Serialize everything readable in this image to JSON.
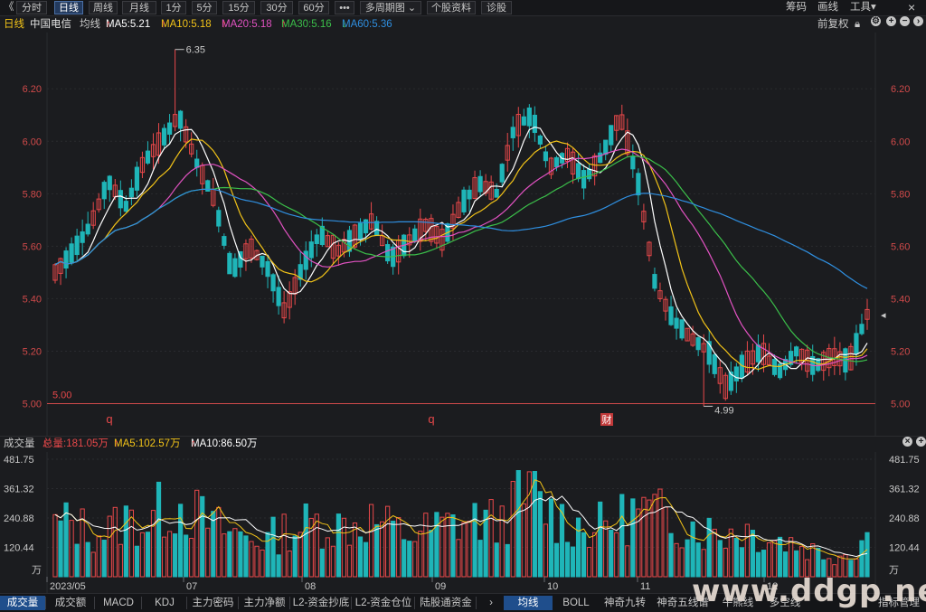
{
  "toolbar": {
    "back": "《",
    "periods": [
      "分时",
      "日线",
      "周线",
      "月线",
      "1分",
      "5分",
      "15分",
      "30分",
      "60分"
    ],
    "active_period": "日线",
    "more": "•••",
    "multi_period": "多周期图",
    "stock_info": "个股资料",
    "diagnose": "诊股",
    "right_tools": [
      "筹码",
      "画线",
      "工具"
    ],
    "close": "×"
  },
  "indicator_bar": {
    "period": "日线",
    "stock_name": "中国电信",
    "mode": "均线",
    "ma5": "MA5:5.21",
    "ma10": "MA10:5.18",
    "ma20": "MA20:5.18",
    "ma30": "MA30:5.16",
    "ma60": "MA60:5.36",
    "adjust": "前复权"
  },
  "colors": {
    "up": "#e8484a",
    "down": "#1fb5b8",
    "ma5": "#ffffff",
    "ma10": "#f2c318",
    "ma20": "#e252c2",
    "ma30": "#3bbf4a",
    "ma60": "#2f8fe0",
    "bg": "#1b1c1f",
    "grid": "#2a2b2f"
  },
  "price_axis": {
    "ticks": [
      "6.20",
      "6.00",
      "5.80",
      "5.60",
      "5.40",
      "5.20",
      "5.00"
    ]
  },
  "annotations": {
    "high": "6.35",
    "low": "4.99",
    "baseline": "5.00",
    "mark_q1": "q",
    "mark_q2": "q",
    "mark_cai": "财"
  },
  "volume_bar": {
    "label": "成交量",
    "total": "总量:181.05万",
    "ma5": "MA5:102.57万",
    "ma10": "MA10:86.50万",
    "ticks": [
      "481.75",
      "361.32",
      "240.88",
      "120.44"
    ],
    "unit": "万"
  },
  "date_axis": [
    "2023/05",
    "07",
    "08",
    "09",
    "10",
    "11",
    "12"
  ],
  "bottom_tabs": {
    "left": [
      "成交量",
      "成交额",
      "MACD",
      "KDJ",
      "主力密码",
      "主力净额",
      "L2-资金抄底",
      "L2-资金仓位",
      "陆股通资金"
    ],
    "right": [
      "均线",
      "BOLL",
      "神奇九转",
      "神奇五线谱",
      "牛熊线",
      "多空线",
      "指标管理"
    ],
    "active_left": "成交量",
    "active_right": "均线"
  },
  "watermark": "www.ddgp.net",
  "chart_data": {
    "type": "candlestick",
    "price_ylim": [
      4.95,
      6.38
    ],
    "volume_ylim": [
      0,
      481.75
    ],
    "candles_ohlc_sample": [
      [
        5.45,
        5.55,
        5.3,
        5.5
      ],
      [
        5.5,
        5.6,
        5.45,
        5.58
      ],
      [
        5.58,
        5.7,
        5.55,
        5.68
      ],
      [
        5.68,
        5.9,
        5.62,
        5.85
      ],
      [
        5.85,
        5.95,
        5.7,
        5.75
      ],
      [
        5.75,
        5.95,
        5.72,
        5.92
      ],
      [
        5.92,
        6.05,
        5.85,
        6.0
      ],
      [
        6.0,
        6.35,
        5.9,
        6.1
      ],
      [
        6.1,
        6.15,
        5.85,
        5.92
      ],
      [
        5.92,
        5.98,
        5.7,
        5.78
      ],
      [
        5.78,
        5.8,
        5.45,
        5.5
      ],
      [
        5.5,
        5.62,
        5.45,
        5.6
      ],
      [
        5.6,
        5.66,
        5.5,
        5.52
      ],
      [
        5.52,
        5.6,
        5.3,
        5.35
      ],
      [
        5.35,
        5.55,
        5.33,
        5.52
      ],
      [
        5.52,
        5.7,
        5.5,
        5.65
      ],
      [
        5.65,
        5.72,
        5.55,
        5.58
      ],
      [
        5.58,
        5.68,
        5.52,
        5.64
      ],
      [
        5.64,
        5.75,
        5.6,
        5.7
      ],
      [
        5.7,
        5.74,
        5.5,
        5.55
      ],
      [
        5.55,
        5.66,
        5.52,
        5.62
      ],
      [
        5.62,
        5.72,
        5.58,
        5.68
      ],
      [
        5.68,
        5.78,
        5.6,
        5.62
      ],
      [
        5.62,
        5.8,
        5.55,
        5.76
      ],
      [
        5.76,
        5.9,
        5.7,
        5.84
      ],
      [
        5.84,
        5.96,
        5.75,
        5.8
      ],
      [
        5.8,
        6.1,
        5.78,
        6.05
      ],
      [
        6.05,
        6.25,
        6.0,
        6.1
      ],
      [
        6.1,
        6.12,
        5.85,
        5.9
      ],
      [
        5.9,
        5.98,
        5.82,
        5.95
      ],
      [
        5.95,
        5.98,
        5.8,
        5.85
      ],
      [
        5.85,
        5.98,
        5.8,
        5.95
      ],
      [
        5.95,
        6.15,
        5.9,
        6.1
      ],
      [
        6.1,
        6.12,
        5.8,
        5.85
      ],
      [
        5.85,
        5.88,
        5.4,
        5.45
      ],
      [
        5.45,
        5.5,
        5.25,
        5.32
      ],
      [
        5.32,
        5.38,
        5.2,
        5.25
      ],
      [
        5.25,
        5.35,
        5.15,
        5.2
      ],
      [
        5.2,
        5.24,
        5.02,
        5.06
      ],
      [
        5.06,
        5.18,
        4.99,
        5.15
      ],
      [
        5.15,
        5.28,
        5.1,
        5.2
      ],
      [
        5.2,
        5.26,
        5.06,
        5.12
      ],
      [
        5.12,
        5.24,
        5.08,
        5.2
      ],
      [
        5.2,
        5.28,
        5.12,
        5.14
      ],
      [
        5.14,
        5.22,
        5.1,
        5.18
      ],
      [
        5.18,
        5.24,
        5.12,
        5.16
      ],
      [
        5.16,
        5.36,
        5.15,
        5.34
      ]
    ],
    "volume_sample": [
      230,
      250,
      200,
      210,
      260,
      240,
      300,
      340,
      280,
      230,
      200,
      180,
      170,
      210,
      230,
      250,
      230,
      240,
      260,
      220,
      190,
      210,
      230,
      250,
      260,
      240,
      320,
      380,
      290,
      250,
      220,
      230,
      260,
      300,
      280,
      260,
      240,
      210,
      200,
      220,
      190,
      170,
      150,
      120,
      100,
      110,
      181.05
    ]
  }
}
